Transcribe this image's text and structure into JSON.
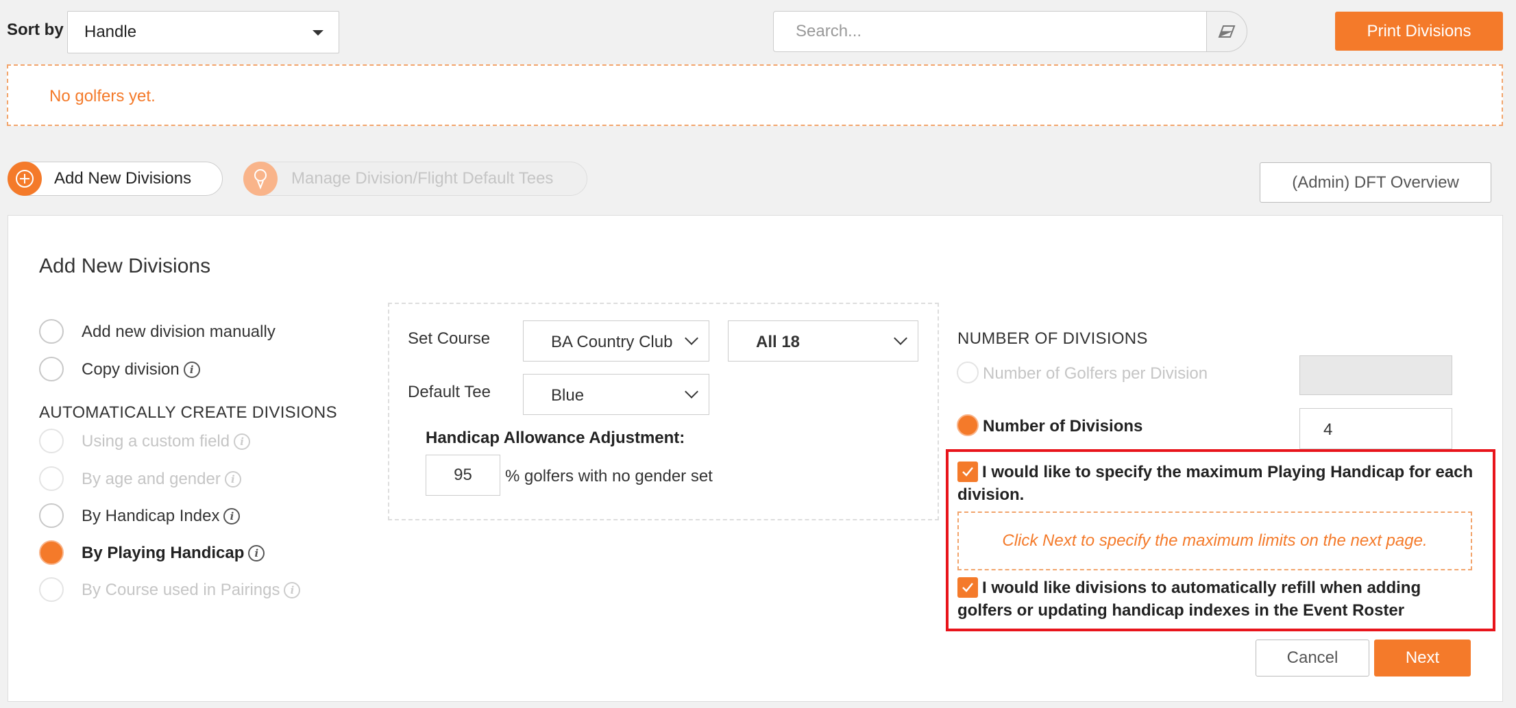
{
  "toolbar": {
    "sort_label": "Sort by",
    "sort_value": "Handle",
    "search_placeholder": "Search...",
    "print_label": "Print Divisions"
  },
  "notice": {
    "text": "No golfers yet."
  },
  "tabs": {
    "add_label": "Add New Divisions",
    "manage_label": "Manage Division/Flight Default Tees",
    "admin_label": "(Admin) DFT Overview"
  },
  "panel": {
    "title": "Add New Divisions",
    "options": {
      "manual": "Add new division manually",
      "copy": "Copy division",
      "auto_heading": "AUTOMATICALLY CREATE DIVISIONS",
      "custom_field": "Using a custom field",
      "age_gender": "By age and gender",
      "handicap_index": "By Handicap Index",
      "playing_handicap": "By Playing Handicap",
      "course_pairings": "By Course used in Pairings"
    },
    "course": {
      "set_course_label": "Set Course",
      "course_value": "BA Country Club",
      "holes_value": "All 18",
      "default_tee_label": "Default Tee",
      "tee_value": "Blue",
      "handicap_label": "Handicap Allowance Adjustment:",
      "handicap_value": "95",
      "handicap_suffix": "% golfers with no gender set"
    },
    "divisions": {
      "heading": "NUMBER OF DIVISIONS",
      "per_division_label": "Number of Golfers per Division",
      "count_label": "Number of Divisions",
      "count_value": "4",
      "max_handicap_label": "I would like to specify the maximum Playing Handicap for each division.",
      "hint": "Click Next to specify the maximum limits on the next page.",
      "refill_label": "I would like divisions to automatically refill when adding golfers or updating handicap indexes in the Event Roster"
    },
    "actions": {
      "cancel": "Cancel",
      "next": "Next"
    }
  },
  "colors": {
    "accent": "#f47a2a",
    "highlight": "#e8141b"
  }
}
